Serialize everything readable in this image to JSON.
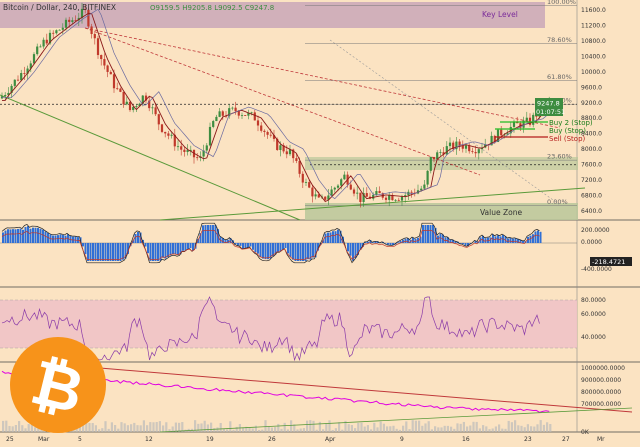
{
  "header": {
    "symbol_title": "Bitcoin / Dollar, 240, BITFINEX",
    "ohlc": "O9159.5 H9205.8 L9092.5 C9247.8"
  },
  "labels": {
    "key_level": "Key Level",
    "value_zone": "Value Zone",
    "buy2": "Buy 2 (Stop)",
    "buy": "Buy (Stop)",
    "sell": "Sell (Stop)",
    "last_price": "9247.8",
    "last_price_sub": "01:07:51",
    "macd_readout": "-218.4721"
  },
  "colors": {
    "background": "#fbe3c2",
    "up_candle": "#3d8c40",
    "down_candle": "#c0392b",
    "key_level_zone": "#c9a7b8",
    "value_zone": "#b9c79a",
    "macd_hist": "#2f6fd6",
    "rsi_band": "#f0c2c7",
    "rsi_line": "#8a3aa8",
    "obv_line": "#e000e0",
    "trendline": "#5a9a3a",
    "dashed_trend": "#c0393b",
    "buy_line": "#22bb22",
    "sell_line": "#b51b1b"
  },
  "chart_data": [
    {
      "type": "candlestick",
      "title": "Bitcoin / Dollar, 240, BITFINEX",
      "y_ticks": [
        11600,
        11200,
        10800,
        10400,
        10000,
        9600,
        9200,
        8800,
        8400,
        8000,
        7600,
        7200,
        6800,
        6400
      ],
      "ylim": [
        6200,
        11800
      ],
      "fib_levels": [
        {
          "label": "100.00%",
          "price": 11710
        },
        {
          "label": "78.60%",
          "price": 10720
        },
        {
          "label": "61.80%",
          "price": 9760
        },
        {
          "label": "50.00%",
          "price": 9150
        },
        {
          "label": "0.00%",
          "price": 6520
        },
        {
          "label": "23.60%",
          "price": 7700
        }
      ],
      "x_tick_labels": [
        "25",
        "Mar",
        "5",
        "12",
        "19",
        "26",
        "Apr",
        "9",
        "16",
        "23",
        "27",
        "Mr"
      ],
      "annotations": [
        "Key Level",
        "Value Zone",
        "Buy 2 (Stop)",
        "Buy (Stop)",
        "Sell (Stop)"
      ],
      "last_price": 9247.8
    },
    {
      "type": "line",
      "title": "MACD",
      "y_ticks": [
        200,
        0,
        -218.4721,
        -400
      ],
      "ylim": [
        -500,
        300
      ]
    },
    {
      "type": "line",
      "title": "RSI",
      "y_ticks": [
        80,
        60,
        40
      ],
      "ylim": [
        20,
        90
      ]
    },
    {
      "type": "line",
      "title": "OBV",
      "y_ticks_labels": [
        "1000000.0000",
        "900000.0000",
        "800000.0000",
        "700000.0000",
        "0K"
      ]
    }
  ]
}
